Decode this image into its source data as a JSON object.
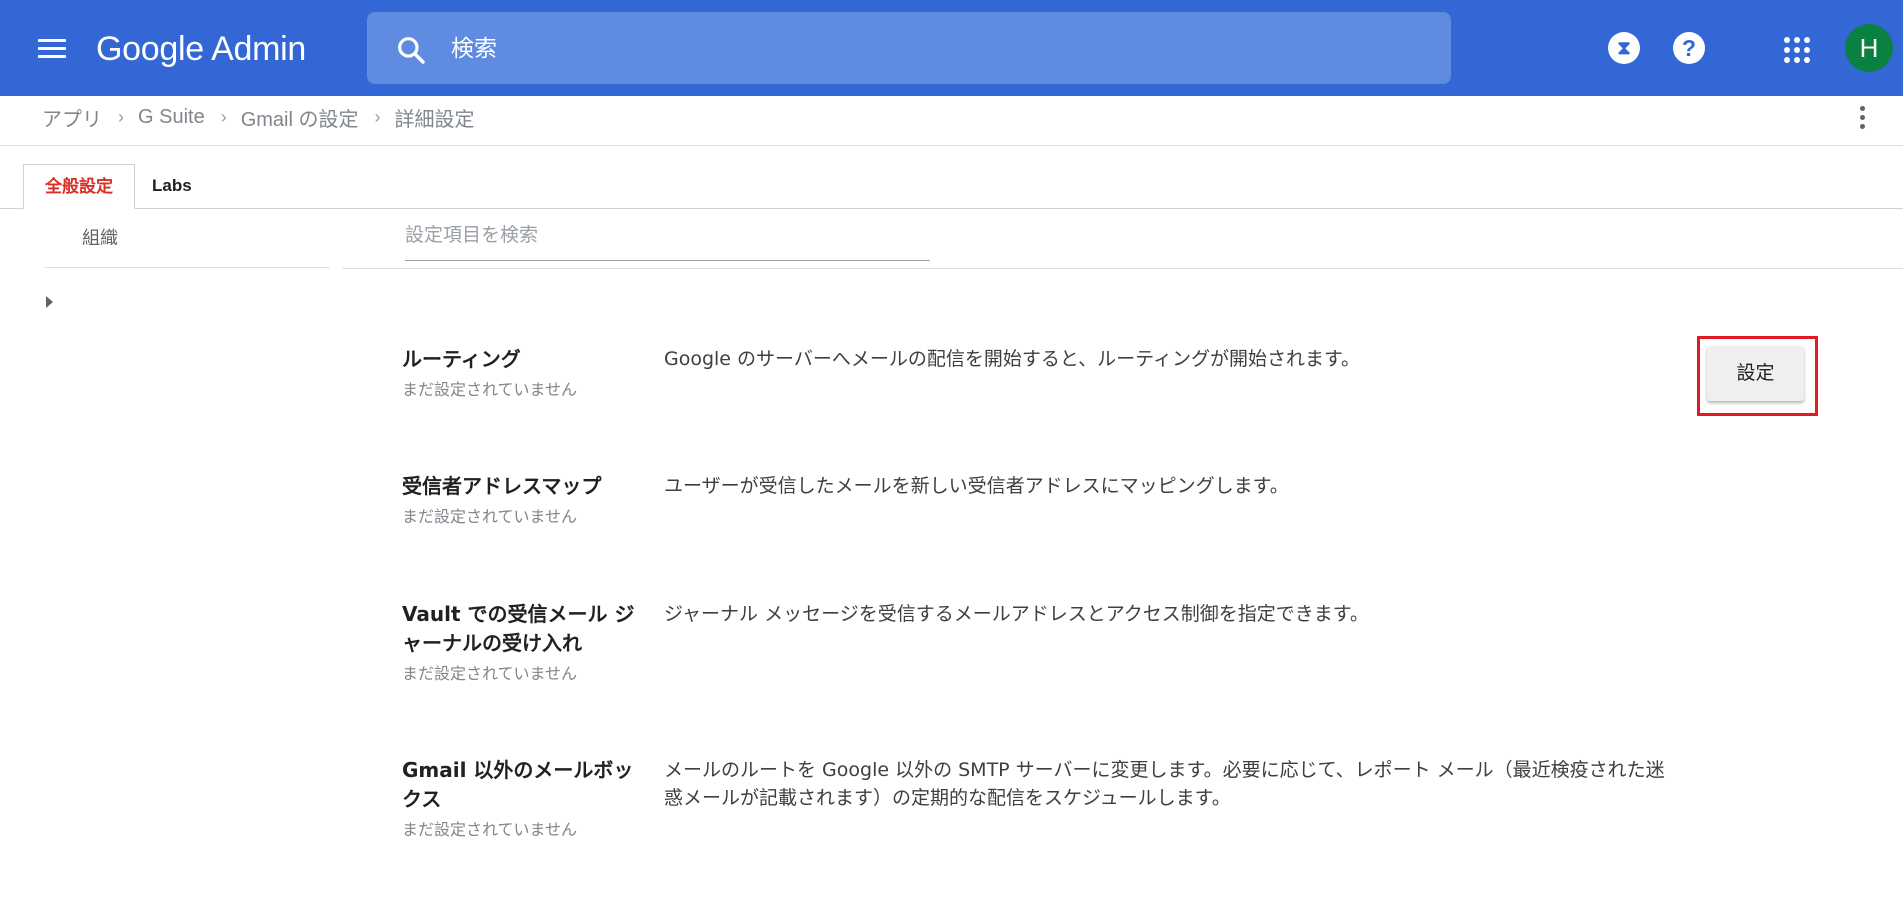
{
  "header": {
    "logo": "Google Admin",
    "search_placeholder": "検索",
    "avatar_initial": "H",
    "icons": [
      "menu-icon",
      "search-icon",
      "hourglass-icon",
      "help-icon",
      "apps-grid-icon"
    ],
    "colors": {
      "bar": "#3367d6",
      "search_bg": "#5f8be0",
      "avatar": "#0b8043"
    }
  },
  "breadcrumb": [
    "アプリ",
    "G Suite",
    "Gmail の設定",
    "詳細設定"
  ],
  "tabs": [
    {
      "label": "全般設定",
      "active": true
    },
    {
      "label": "Labs",
      "active": false
    }
  ],
  "org_panel": {
    "label": "組織"
  },
  "settings_search": {
    "placeholder": "設定項目を検索"
  },
  "settings": [
    {
      "title": "ルーティング",
      "status": "まだ設定されていません",
      "description": "Google のサーバーへメールの配信を開始すると、ルーティングが開始されます。",
      "button": "設定"
    },
    {
      "title": "受信者アドレスマップ",
      "status": "まだ設定されていません",
      "description": "ユーザーが受信したメールを新しい受信者アドレスにマッピングします。"
    },
    {
      "title": "Vault での受信メール ジャーナルの受け入れ",
      "status": "まだ設定されていません",
      "description": "ジャーナル メッセージを受信するメールアドレスとアクセス制御を指定できます。"
    },
    {
      "title": "Gmail 以外のメールボックス",
      "status": "まだ設定されていません",
      "description": "メールのルートを Google 以外の SMTP サーバーに変更します。必要に応じて、レポート メール（最近検疫された迷惑メールが記載されます）の定期的な配信をスケジュールします。"
    }
  ],
  "highlight_color": "#e01b24"
}
